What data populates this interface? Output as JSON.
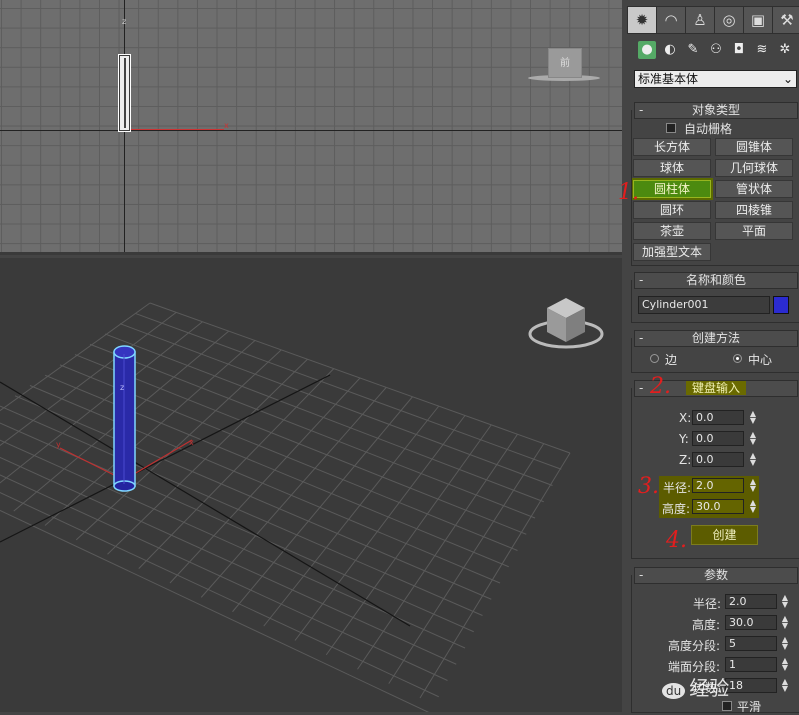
{
  "viewports": {
    "top": {
      "axis_z": "z",
      "axis_x": "x",
      "viewcube_label": "前"
    },
    "perspective": {
      "axis_z": "z",
      "axis_x": "x",
      "axis_y": "y"
    }
  },
  "command_panel": {
    "tabs": [
      {
        "icon": "create-icon",
        "glyph": "✹",
        "active": true
      },
      {
        "icon": "modify-icon",
        "glyph": "◠",
        "active": false
      },
      {
        "icon": "hierarchy-icon",
        "glyph": "♙",
        "active": false
      },
      {
        "icon": "motion-icon",
        "glyph": "◎",
        "active": false
      },
      {
        "icon": "display-icon",
        "glyph": "▣",
        "active": false
      },
      {
        "icon": "utilities-icon",
        "glyph": "⚒",
        "active": false
      }
    ],
    "categories": [
      {
        "icon": "geometry-icon",
        "glyph": "●"
      },
      {
        "icon": "shapes-icon",
        "glyph": "◐"
      },
      {
        "icon": "lights-icon",
        "glyph": "✎"
      },
      {
        "icon": "cameras-icon",
        "glyph": "⚇"
      },
      {
        "icon": "helpers-icon",
        "glyph": "◘"
      },
      {
        "icon": "spacewarps-icon",
        "glyph": "≋"
      },
      {
        "icon": "systems-icon",
        "glyph": "✲"
      }
    ],
    "object_type_dropdown": "标准基本体",
    "object_type": {
      "title": "对象类型",
      "autogrid_label": "自动栅格",
      "buttons": [
        {
          "label": "长方体"
        },
        {
          "label": "圆锥体"
        },
        {
          "label": "球体"
        },
        {
          "label": "几何球体"
        },
        {
          "label": "圆柱体",
          "active": true
        },
        {
          "label": "管状体"
        },
        {
          "label": "圆环"
        },
        {
          "label": "四棱锥"
        },
        {
          "label": "茶壶"
        },
        {
          "label": "平面"
        },
        {
          "label": "加强型文本"
        }
      ]
    },
    "name_color": {
      "title": "名称和颜色",
      "name_value": "Cylinder001",
      "color": "#2b2bd0"
    },
    "creation_method": {
      "title": "创建方法",
      "opt_edge": "边",
      "opt_center": "中心",
      "selected": "中心"
    },
    "keyboard_entry": {
      "title": "键盘输入",
      "x_label": "X:",
      "x_value": "0.0",
      "y_label": "Y:",
      "y_value": "0.0",
      "z_label": "Z:",
      "z_value": "0.0",
      "radius_label": "半径:",
      "radius_value": "2.0",
      "height_label": "高度:",
      "height_value": "30.0",
      "create_button": "创建"
    },
    "parameters": {
      "title": "参数",
      "radius_label": "半径:",
      "radius_value": "2.0",
      "height_label": "高度:",
      "height_value": "30.0",
      "height_segs_label": "高度分段:",
      "height_segs_value": "5",
      "cap_segs_label": "端面分段:",
      "cap_segs_value": "1",
      "sides_label": "边数:",
      "sides_value": "18",
      "smooth_label": "平滑"
    }
  },
  "annotations": [
    "1.",
    "2.",
    "3.",
    "4."
  ],
  "watermark": "经验"
}
